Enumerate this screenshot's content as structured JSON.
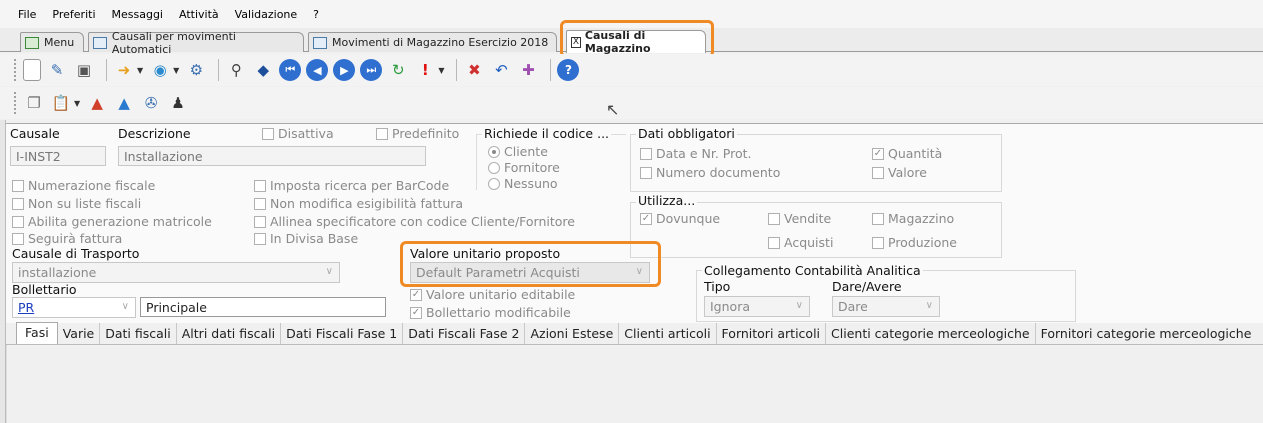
{
  "menu": [
    "File",
    "Preferiti",
    "Messaggi",
    "Attività",
    "Validazione",
    "?"
  ],
  "tabs": [
    {
      "label": "Menu"
    },
    {
      "label": "Causali per movimenti Automatici"
    },
    {
      "label": "Movimenti di Magazzino Esercizio 2018"
    },
    {
      "label": "Causali di Magazzino",
      "active": true,
      "close": "X"
    }
  ],
  "form": {
    "causale_label": "Causale",
    "causale_value": "I-INST2",
    "descrizione_label": "Descrizione",
    "descrizione_value": "Installazione",
    "disattiva": "Disattiva",
    "predefinito": "Predefinito",
    "richiede_label": "Richiede il codice ...",
    "richiede_options": [
      "Cliente",
      "Fornitore",
      "Nessuno"
    ],
    "dati_obbligatori_label": "Dati obbligatori",
    "data_prot": "Data e Nr. Prot.",
    "numero_documento": "Numero documento",
    "quantita": "Quantità",
    "valore": "Valore",
    "utilizza_label": "Utilizza...",
    "dovunque": "Dovunque",
    "vendite": "Vendite",
    "magazzino": "Magazzino",
    "acquisti": "Acquisti",
    "produzione": "Produzione",
    "left_checks": [
      "Numerazione fiscale",
      "Non su liste fiscali",
      "Abilita generazione matricole",
      "Seguirà fattura"
    ],
    "mid_checks": [
      "Imposta ricerca per BarCode",
      "Non modifica esigibilità fattura",
      "Allinea specificatore con codice Cliente/Fornitore",
      "In Divisa Base"
    ],
    "causale_trasporto_label": "Causale di Trasporto",
    "causale_trasporto_value": "installazione",
    "bollettario_label": "Bollettario",
    "bollettario_code": "PR",
    "bollettario_value": "Principale",
    "valore_unitario_label": "Valore unitario proposto",
    "valore_unitario_value": "Default Parametri Acquisti",
    "valore_editabile": "Valore unitario editabile",
    "bollettario_modificabile": "Bollettario modificabile",
    "collegamento_label": "Collegamento Contabilità Analitica",
    "tipo_label": "Tipo",
    "tipo_value": "Ignora",
    "dare_avere_label": "Dare/Avere",
    "dare_avere_value": "Dare"
  },
  "bottom_tabs": [
    "Fasi",
    "Varie",
    "Dati fiscali",
    "Altri dati fiscali",
    "Dati Fiscali Fase 1",
    "Dati Fiscali Fase 2",
    "Azioni Estese",
    "Clienti articoli",
    "Fornitori articoli",
    "Clienti categorie merceologiche",
    "Fornitori categorie merceologiche"
  ],
  "colors": {
    "highlight": "#f08a24",
    "link": "#1a3fbf"
  }
}
